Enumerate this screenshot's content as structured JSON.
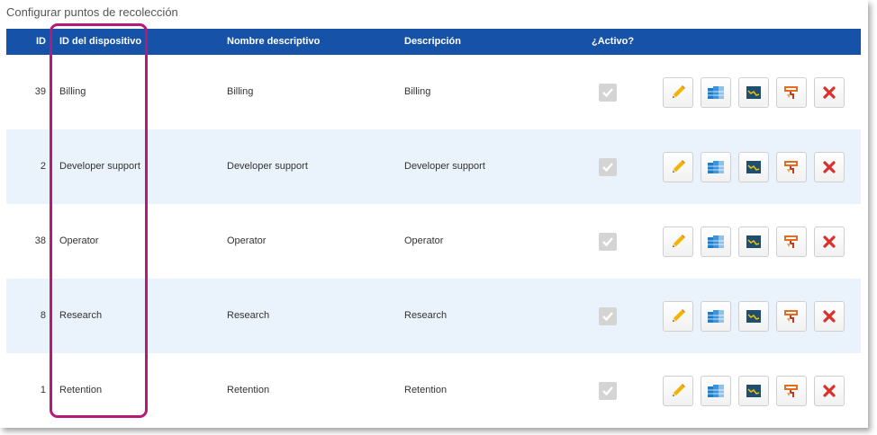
{
  "page": {
    "title": "Configurar puntos de recolección"
  },
  "table": {
    "headers": {
      "id": "ID",
      "device_id": "ID del dispositivo",
      "name": "Nombre descriptivo",
      "description": "Descripción",
      "active": "¿Activo?"
    },
    "rows": [
      {
        "id": "39",
        "device_id": "Billing",
        "name": "Billing",
        "description": "Billing",
        "active": true
      },
      {
        "id": "2",
        "device_id": "Developer support",
        "name": "Developer support",
        "description": "Developer support",
        "active": true
      },
      {
        "id": "38",
        "device_id": "Operator",
        "name": "Operator",
        "description": "Operator",
        "active": true
      },
      {
        "id": "8",
        "device_id": "Research",
        "name": "Research",
        "description": "Research",
        "active": true
      },
      {
        "id": "1",
        "device_id": "Retention",
        "name": "Retention",
        "description": "Retention",
        "active": true
      }
    ],
    "row_actions": [
      "pencil-icon",
      "columns-icon",
      "chart-icon",
      "paint-roller-icon",
      "delete-x-icon"
    ]
  },
  "colors": {
    "header_bg": "#1653a8",
    "alt_row_bg": "#eaf3fb",
    "highlight": "#b5197a",
    "delete": "#d9302c"
  }
}
